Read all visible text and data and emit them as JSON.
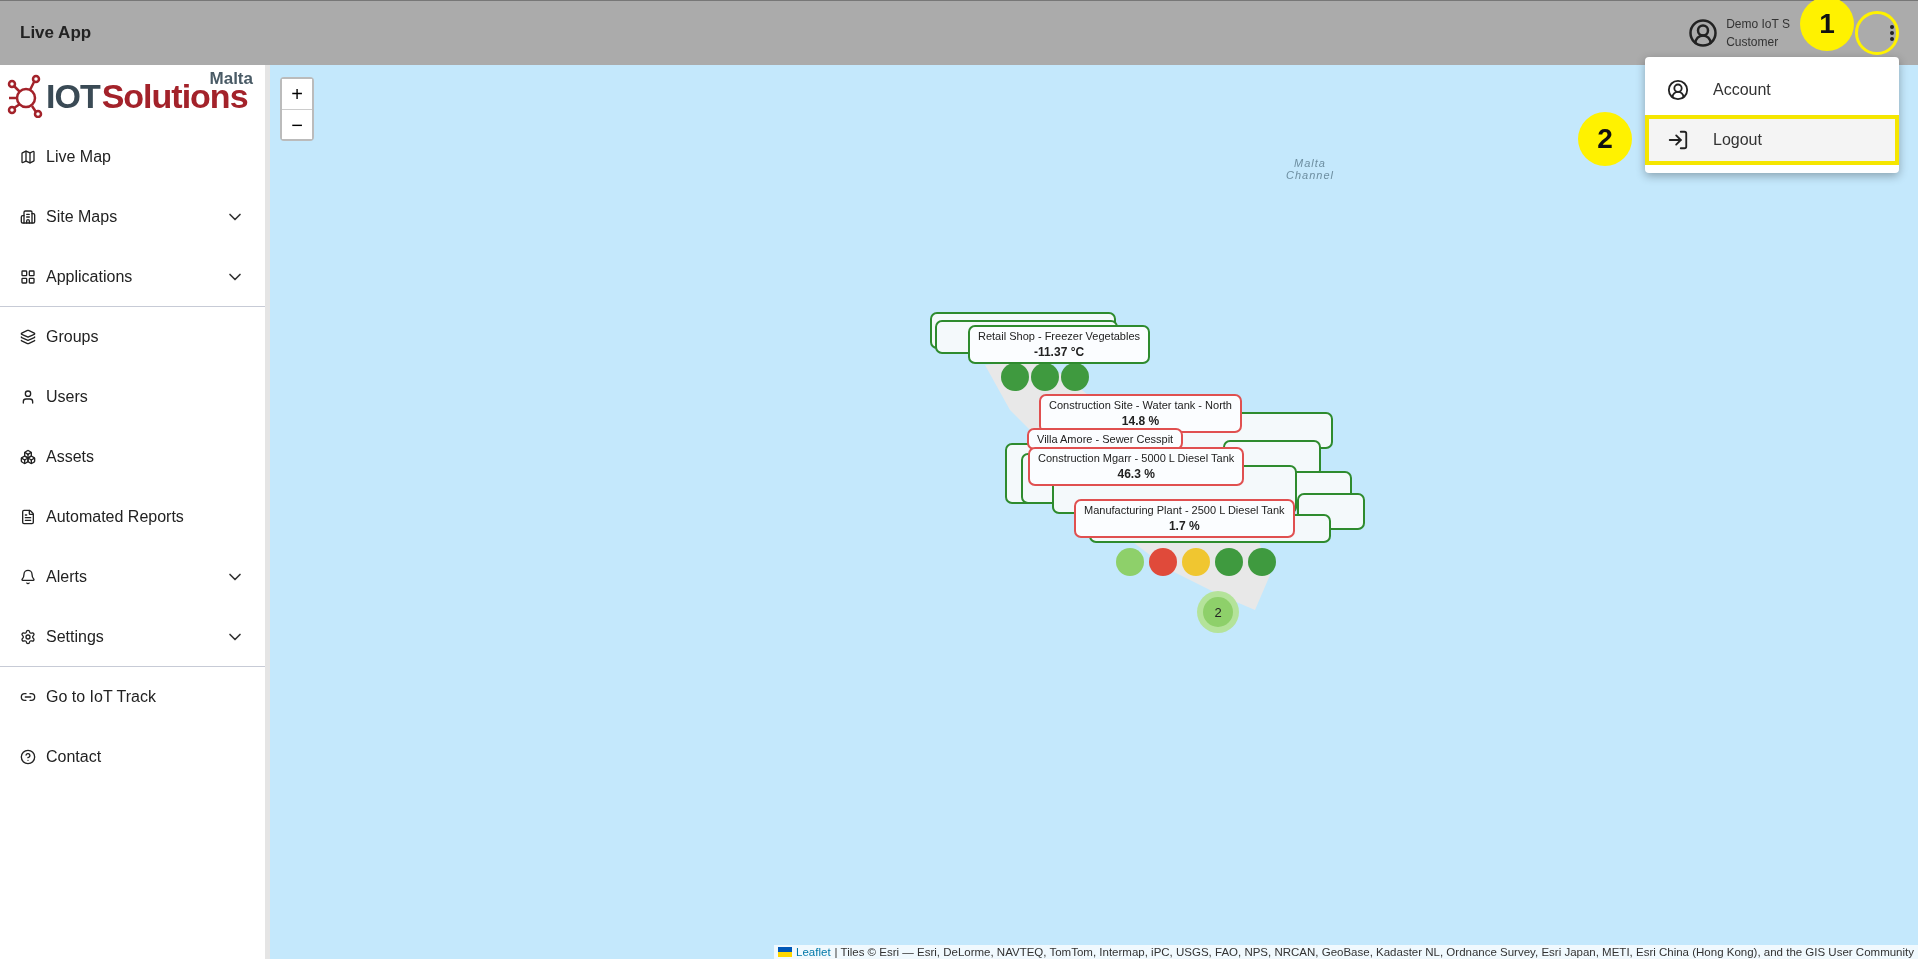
{
  "header": {
    "title": "Live App",
    "user": {
      "name": "Demo IoT S",
      "role": "Customer"
    }
  },
  "user_menu": {
    "items": [
      {
        "label": "Account",
        "selected": false
      },
      {
        "label": "Logout",
        "selected": true
      }
    ]
  },
  "annotations": [
    {
      "number": "1"
    },
    {
      "number": "2"
    }
  ],
  "sidebar": {
    "logo": {
      "part_1": "IOT",
      "part_2": "Solutions",
      "region": "Malta"
    },
    "items": [
      {
        "label": "Live Map",
        "expandable": false,
        "divider_after": false
      },
      {
        "label": "Site Maps",
        "expandable": true,
        "divider_after": false
      },
      {
        "label": "Applications",
        "expandable": true,
        "divider_after": true
      },
      {
        "label": "Groups",
        "expandable": false,
        "divider_after": false
      },
      {
        "label": "Users",
        "expandable": false,
        "divider_after": false
      },
      {
        "label": "Assets",
        "expandable": false,
        "divider_after": false
      },
      {
        "label": "Automated Reports",
        "expandable": false,
        "divider_after": false
      },
      {
        "label": "Alerts",
        "expandable": true,
        "divider_after": false
      },
      {
        "label": "Settings",
        "expandable": true,
        "divider_after": true
      },
      {
        "label": "Go to IoT Track",
        "expandable": false,
        "divider_after": false
      },
      {
        "label": "Contact",
        "expandable": false,
        "divider_after": false
      }
    ]
  },
  "map": {
    "zoom_in": "+",
    "zoom_out": "−",
    "place_label": "Malta Channel",
    "labels": [
      {
        "title": "Retail Shop - Freezer Vegetables",
        "value": "-11.37 °C",
        "color": "#2e8b2e"
      },
      {
        "title": "Construction Site - Water tank - North",
        "value": "14.8 %",
        "color": "#e05050"
      },
      {
        "title": "Villa Amore - Sewer Cesspit",
        "color": "#e05050"
      },
      {
        "title": "Construction Mgarr - 5000 L Diesel Tank",
        "value": "46.3 %",
        "color": "#e05050"
      },
      {
        "title": "Manufacturing Plant - 2500 L Diesel Tank",
        "value": "1.7 %",
        "color": "#e05050"
      }
    ],
    "cluster": "2",
    "attribution": {
      "link": "Leaflet",
      "text": "| Tiles © Esri — Esri, DeLorme, NAVTEQ, TomTom, Intermap, iPC, USGS, FAO, NPS, NRCAN, GeoBase, Kadaster NL, Ordnance Survey, Esri Japan, METI, Esri China (Hong Kong), and the GIS User Community"
    }
  }
}
